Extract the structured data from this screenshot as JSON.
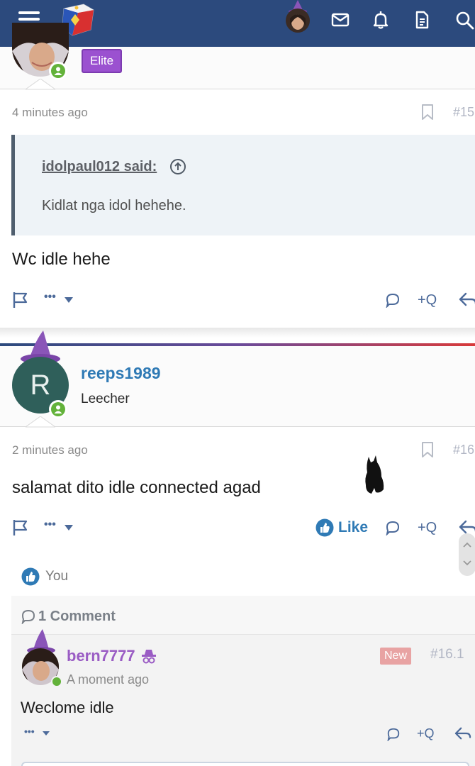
{
  "colors": {
    "nav_bg": "#2c4a7d",
    "accent_blue": "#2f7ab5",
    "elite_purple": "#9b51d0",
    "online_green": "#63b23a",
    "new_badge": "#e8a3a3"
  },
  "topbar": {
    "icons": [
      "menu-icon",
      "site-logo",
      "user-avatar",
      "mail-icon",
      "bell-icon",
      "document-icon",
      "search-icon"
    ]
  },
  "post15": {
    "badge": "Elite",
    "time": "4 minutes ago",
    "number": "#15",
    "quote_author": "idolpaul012 said:",
    "quote_text": "Kidlat nga idol hehehe.",
    "message": "Wc idle hehe",
    "reply_quote": "+Q"
  },
  "post16": {
    "avatar_letter": "R",
    "username": "reeps1989",
    "user_title": "Leecher",
    "time": "2 minutes ago",
    "number": "#16",
    "message": "salamat dito idle connected agad",
    "like_label": "Like",
    "reply_quote": "+Q",
    "reaction_user": "You"
  },
  "comments": {
    "header": "1 Comment",
    "items": [
      {
        "username": "bern7777",
        "time": "A moment ago",
        "new_label": "New",
        "number": "#16.1",
        "text": "Weclome idle",
        "reply_quote": "+Q"
      }
    ]
  },
  "actions": {
    "more": "•••"
  }
}
